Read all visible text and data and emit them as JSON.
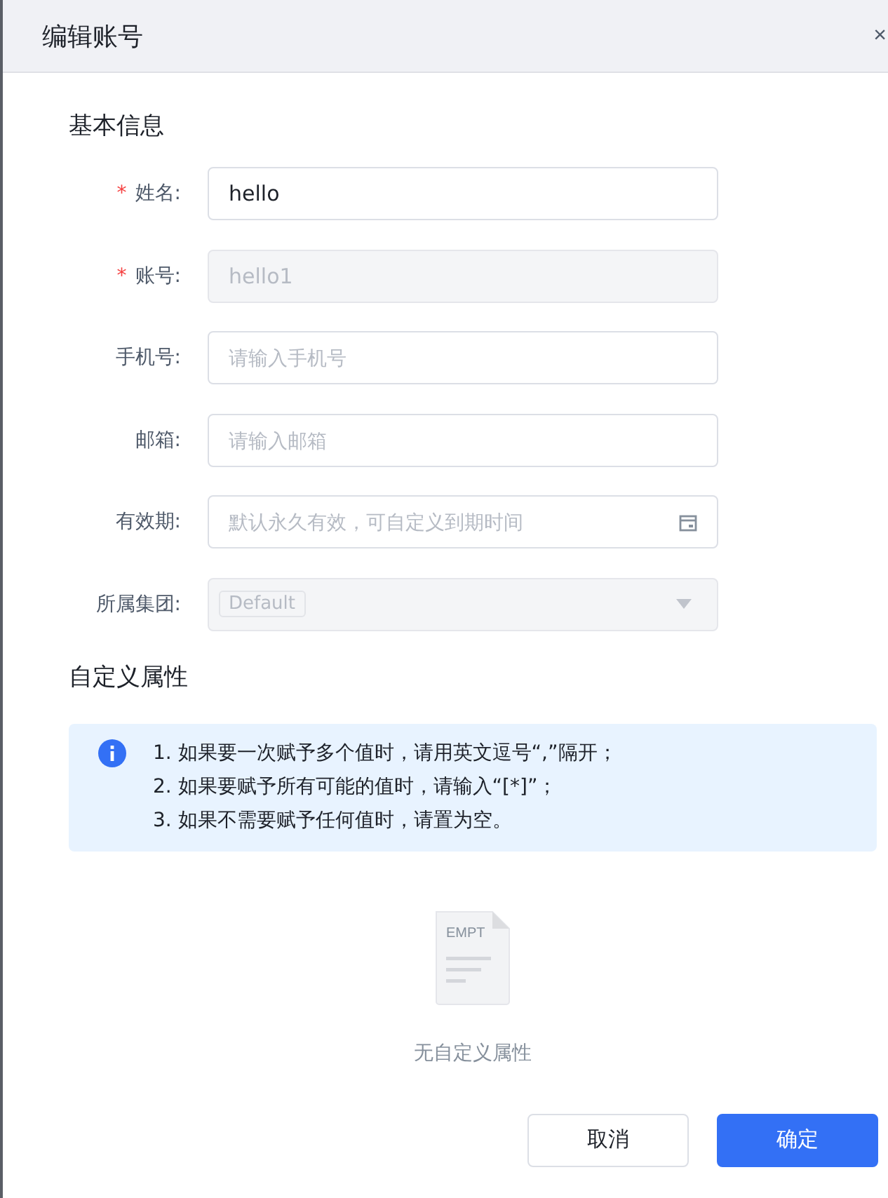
{
  "dialog": {
    "title": "编辑账号",
    "close": "×"
  },
  "basic_section": {
    "title": "基本信息",
    "fields": [
      {
        "kind": "text",
        "label": "姓名:",
        "required_mark": "*",
        "value": "hello",
        "disabled": false
      },
      {
        "kind": "text",
        "label": "账号:",
        "required_mark": "*",
        "value": "hello1",
        "disabled": true
      },
      {
        "kind": "text",
        "label": "手机号:",
        "placeholder": "请输入手机号",
        "disabled": false
      },
      {
        "kind": "text",
        "label": "邮箱:",
        "placeholder": "请输入邮箱",
        "disabled": false
      },
      {
        "kind": "date",
        "label": "有效期:",
        "placeholder": "默认永久有效，可自定义到期时间",
        "disabled": false
      },
      {
        "kind": "select",
        "label": "所属集团:",
        "tag": "Default",
        "disabled": true
      }
    ]
  },
  "custom_section": {
    "title": "自定义属性",
    "notice": [
      "1. 如果要一次赋予多个值时，请用英文逗号“,”隔开；",
      "2. 如果要赋予所有可能的值时，请输入“[*]”；",
      "3. 如果不需要赋予任何值时，请置为空。"
    ],
    "empty": {
      "illustration_text": "EMPT",
      "text": "无自定义属性"
    }
  },
  "buttons": [
    {
      "label": "取消",
      "kind": "default"
    },
    {
      "label": "确定",
      "kind": "primary"
    }
  ]
}
